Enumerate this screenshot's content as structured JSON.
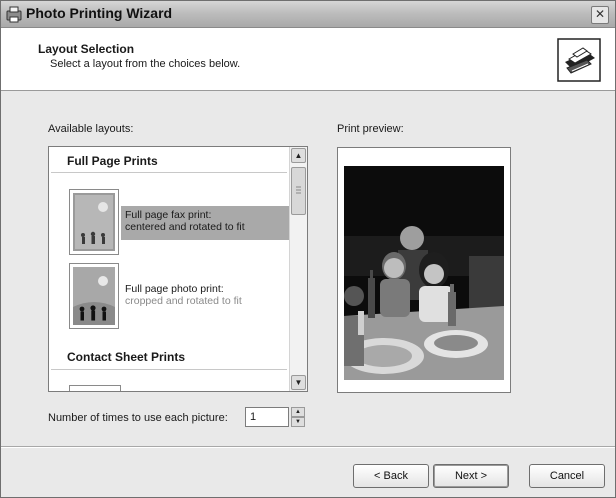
{
  "window": {
    "title": "Photo Printing Wizard",
    "close_glyph": "✕"
  },
  "header": {
    "title": "Layout Selection",
    "subtitle": "Select a layout from the choices below.",
    "icon": "printer-icon"
  },
  "layouts": {
    "label": "Available layouts:",
    "groups": [
      {
        "title": "Full Page Prints",
        "items": [
          {
            "line1": "Full page fax print:",
            "line2": "centered and rotated to fit",
            "selected": true,
            "thumb_icon": "fax-print-thumbnail"
          },
          {
            "line1": "Full page photo print:",
            "line2": "cropped and rotated to fit",
            "selected": false,
            "thumb_icon": "photo-print-thumbnail"
          }
        ]
      },
      {
        "title": "Contact Sheet Prints",
        "items": []
      }
    ]
  },
  "preview": {
    "label": "Print preview:"
  },
  "copies": {
    "label": "Number of times to use each picture:",
    "value": "1"
  },
  "buttons": {
    "back": "< Back",
    "next": "Next >",
    "cancel": "Cancel"
  },
  "colors": {
    "selection": "#a9a9a9",
    "window_bg": "#e9e9e9"
  }
}
